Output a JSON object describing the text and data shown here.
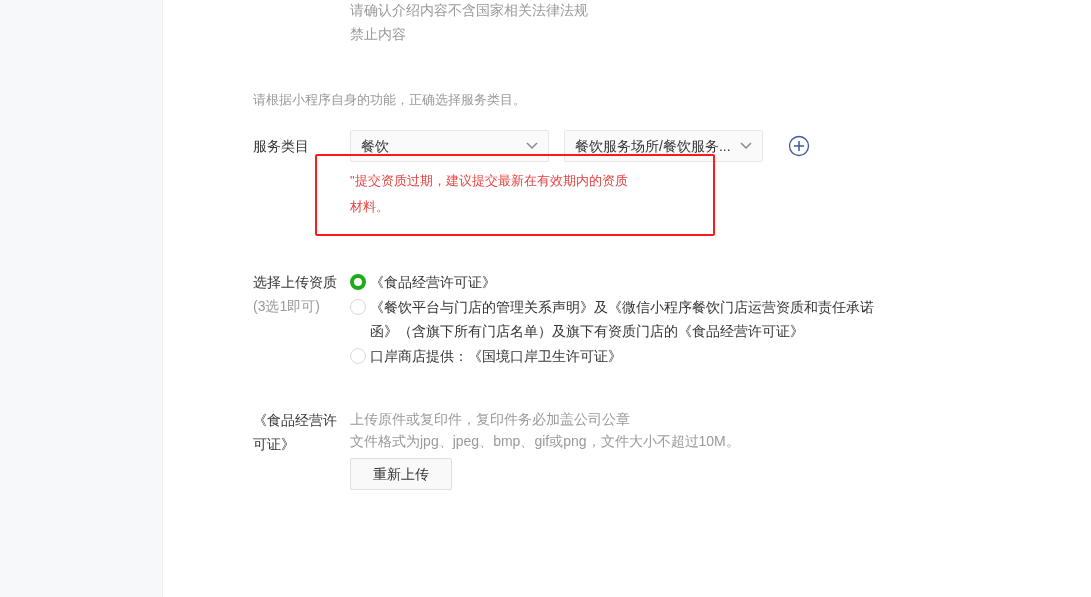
{
  "intro_notes": [
    "请确认介绍内容不含国家相关法律法规",
    "禁止内容"
  ],
  "category_hint": "请根据小程序自身的功能，正确选择服务类目。",
  "service_category": {
    "label": "服务类目",
    "selects": [
      {
        "value": "餐饮"
      },
      {
        "value": "餐饮服务场所/餐饮服务..."
      }
    ],
    "error": "\"提交资质过期，建议提交最新在有效期内的资质材料。"
  },
  "qualification": {
    "label": "选择上传资质",
    "sublabel": "(3选1即可)",
    "options": [
      {
        "label": "《食品经营许可证》",
        "selected": true
      },
      {
        "label": "《餐饮平台与门店的管理关系声明》及《微信小程序餐饮门店运营资质和责任承诺函》（含旗下所有门店名单）及旗下有资质门店的《食品经营许可证》",
        "selected": false
      },
      {
        "label": "口岸商店提供：《国境口岸卫生许可证》",
        "selected": false
      }
    ]
  },
  "upload": {
    "label": "《食品经营许可证》",
    "hints": [
      "上传原件或复印件，复印件务必加盖公司公章",
      "文件格式为jpg、jpeg、bmp、gif或png，文件大小不超过10M。"
    ],
    "button": "重新上传"
  }
}
